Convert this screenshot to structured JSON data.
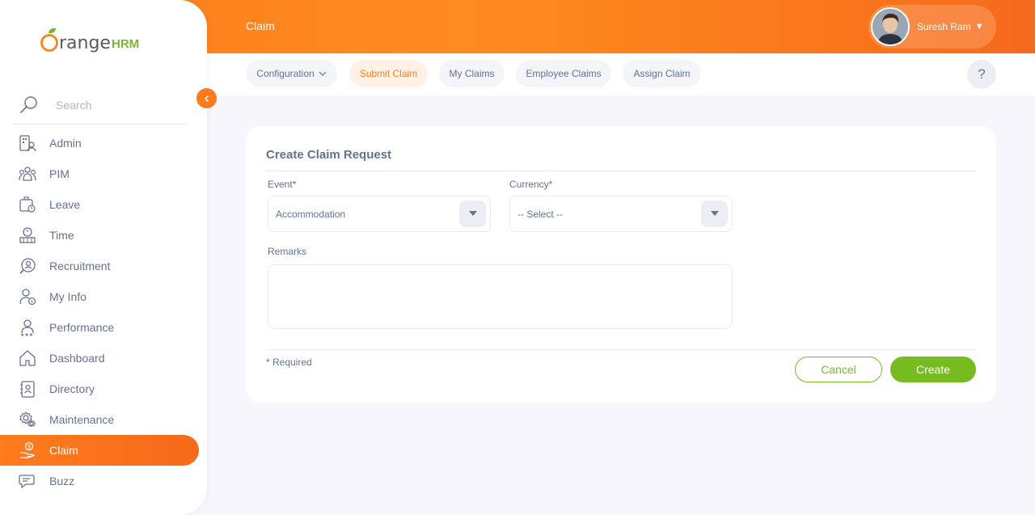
{
  "header": {
    "module_title": "Claim",
    "user_name": "Suresh Ram"
  },
  "subnav": {
    "tabs": [
      {
        "label": "Configuration",
        "has_dropdown": true
      },
      {
        "label": "Submit Claim",
        "active": true
      },
      {
        "label": "My Claims"
      },
      {
        "label": "Employee Claims"
      },
      {
        "label": "Assign Claim"
      }
    ],
    "help_label": "?"
  },
  "sidebar": {
    "logo": {
      "brand_a": "range",
      "brand_b": "HRM"
    },
    "search_placeholder": "Search",
    "items": [
      {
        "label": "Admin",
        "icon": "admin-icon"
      },
      {
        "label": "PIM",
        "icon": "pim-icon"
      },
      {
        "label": "Leave",
        "icon": "leave-icon"
      },
      {
        "label": "Time",
        "icon": "time-icon"
      },
      {
        "label": "Recruitment",
        "icon": "recruitment-icon"
      },
      {
        "label": "My Info",
        "icon": "my-info-icon"
      },
      {
        "label": "Performance",
        "icon": "performance-icon"
      },
      {
        "label": "Dashboard",
        "icon": "dashboard-icon"
      },
      {
        "label": "Directory",
        "icon": "directory-icon"
      },
      {
        "label": "Maintenance",
        "icon": "maintenance-icon"
      },
      {
        "label": "Claim",
        "icon": "claim-icon",
        "active": true
      },
      {
        "label": "Buzz",
        "icon": "buzz-icon"
      }
    ]
  },
  "form": {
    "title": "Create Claim Request",
    "event_label": "Event*",
    "event_value": "Accommodation",
    "currency_label": "Currency*",
    "currency_value": "-- Select --",
    "remarks_label": "Remarks",
    "remarks_value": "",
    "required_note": "* Required",
    "cancel_label": "Cancel",
    "create_label": "Create"
  },
  "colors": {
    "brand_orange": "#ff7b1d",
    "brand_green": "#76bc21",
    "text": "#64728c",
    "background": "#f6f6fb"
  }
}
